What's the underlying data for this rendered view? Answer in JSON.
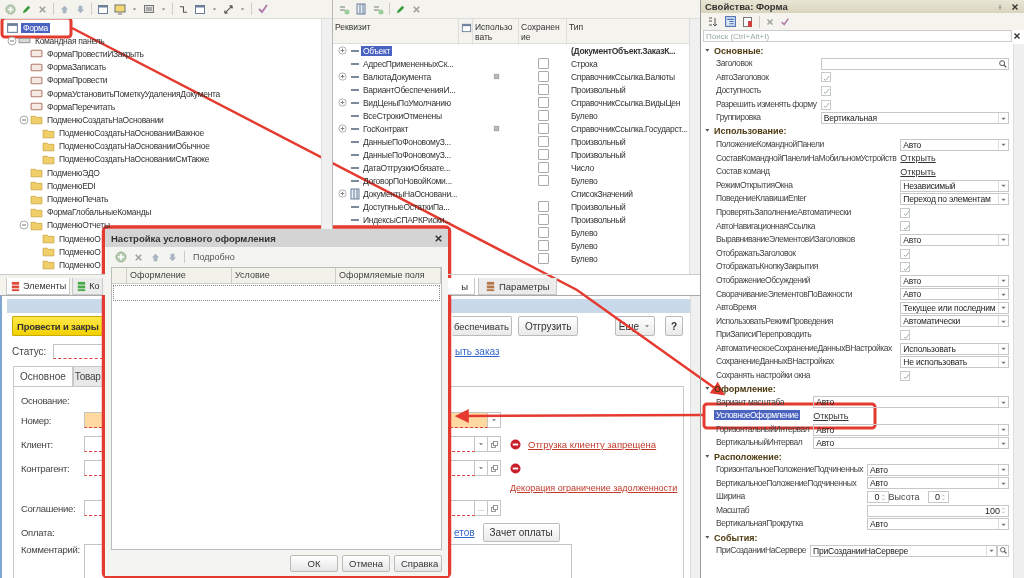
{
  "elements_tree": {
    "root": {
      "label": "Форма",
      "selected": true
    },
    "items": [
      {
        "label": "Командная панель",
        "kind": "panel",
        "expanded": true,
        "selected": false,
        "children": [
          {
            "label": "ФормаПровестиИЗакрыть",
            "kind": "button",
            "selected": false
          },
          {
            "label": "ФормаЗаписать",
            "kind": "button",
            "selected": false
          },
          {
            "label": "ФормаПровести",
            "kind": "button",
            "selected": false
          },
          {
            "label": "ФормаУстановитьПометкуУдаленияДокумента",
            "kind": "button",
            "selected": false
          },
          {
            "label": "ФормаПеречитать",
            "kind": "button",
            "selected": false
          },
          {
            "label": "ПодменюСоздатьНаОсновании",
            "kind": "submenu",
            "expanded": true,
            "selected": false,
            "children": [
              {
                "label": "ПодменюСоздатьНаОснованииВажное",
                "kind": "submenu",
                "selected": false
              },
              {
                "label": "ПодменюСоздатьНаОснованииОбычное",
                "kind": "submenu",
                "selected": false
              },
              {
                "label": "ПодменюСоздатьНаОснованииСмТакже",
                "kind": "submenu",
                "selected": false
              }
            ]
          },
          {
            "label": "ПодменюЭДО",
            "kind": "submenu",
            "selected": false
          },
          {
            "label": "ПодменюEDI",
            "kind": "submenu",
            "selected": false
          },
          {
            "label": "ПодменюПечать",
            "kind": "submenu",
            "selected": false
          },
          {
            "label": "ФормаГлобальныеКоманды",
            "kind": "submenu",
            "selected": false
          },
          {
            "label": "ПодменюОтчеты",
            "kind": "submenu",
            "expanded": true,
            "selected": false,
            "children": [
              {
                "label": "ПодменюО",
                "kind": "submenu",
                "selected": false
              },
              {
                "label": "ПодменюО",
                "kind": "submenu",
                "selected": false
              },
              {
                "label": "ПодменюО",
                "kind": "submenu",
                "selected": false
              }
            ]
          }
        ]
      }
    ],
    "tabs": [
      {
        "label": "Элементы",
        "selected": true
      },
      {
        "label": "Ко",
        "selected": false
      }
    ]
  },
  "attributes": {
    "columns": [
      "Реквизит",
      "Использовать",
      "Сохранение",
      "Тип"
    ],
    "rows": [
      {
        "name": "Объект",
        "kind": "object",
        "expandable": true,
        "used": false,
        "selected": true,
        "type": "(ДокументОбъект.ЗаказК..."
      },
      {
        "name": "АдресПримененныхСк...",
        "kind": "attribute",
        "expandable": false,
        "used": false,
        "saved": false,
        "selected": false,
        "type": "Строка"
      },
      {
        "name": "ВалютаДокумента",
        "kind": "attribute",
        "expandable": true,
        "used": true,
        "saved": false,
        "selected": false,
        "type": "СправочникСсылка.Валюты"
      },
      {
        "name": "ВариантОбеспеченияИ...",
        "kind": "attribute",
        "expandable": false,
        "used": false,
        "saved": false,
        "selected": false,
        "type": "Произвольный"
      },
      {
        "name": "ВидЦеныПоУмолчанию",
        "kind": "attribute",
        "expandable": true,
        "used": false,
        "saved": false,
        "selected": false,
        "type": "СправочникСсылка.ВидыЦен"
      },
      {
        "name": "ВсеСтрокиОтменены",
        "kind": "attribute",
        "expandable": false,
        "used": false,
        "saved": false,
        "selected": false,
        "type": "Булево"
      },
      {
        "name": "ГосКонтракт",
        "kind": "attribute",
        "expandable": true,
        "used": true,
        "saved": false,
        "selected": false,
        "type": "СправочникСсылка.Государст..."
      },
      {
        "name": "ДанныеПоФоновомуЗ...",
        "kind": "attribute",
        "expandable": false,
        "used": false,
        "saved": false,
        "selected": false,
        "type": "Произвольный"
      },
      {
        "name": "ДанныеПоФоновомуЗ...",
        "kind": "attribute",
        "expandable": false,
        "used": false,
        "saved": false,
        "selected": false,
        "type": "Произвольный"
      },
      {
        "name": "ДатаОтгрузкиОбязате...",
        "kind": "attribute",
        "expandable": false,
        "used": false,
        "saved": false,
        "selected": false,
        "type": "Число"
      },
      {
        "name": "ДоговорПоНовойКоми...",
        "kind": "attribute",
        "expandable": false,
        "used": false,
        "saved": false,
        "selected": false,
        "type": "Булево"
      },
      {
        "name": "ДокументыНаОсновани...",
        "kind": "list",
        "expandable": true,
        "used": false,
        "selected": false,
        "type": "СписокЗначений"
      },
      {
        "name": "ДоступныеОстаткиПа...",
        "kind": "attribute",
        "expandable": false,
        "used": false,
        "saved": false,
        "selected": false,
        "type": "Произвольный"
      },
      {
        "name": "ИндексыСПАРКРиски...",
        "kind": "attribute",
        "expandable": false,
        "used": false,
        "saved": false,
        "selected": false,
        "type": "Произвольный"
      },
      {
        "kind": "attribute",
        "expandable": false,
        "used": false,
        "saved": false,
        "selected": false,
        "type": "Булево"
      },
      {
        "kind": "attribute",
        "expandable": false,
        "used": false,
        "saved": false,
        "selected": false,
        "type": "Булево"
      },
      {
        "kind": "attribute",
        "expandable": false,
        "used": false,
        "saved": false,
        "selected": false,
        "type": "Булево"
      }
    ],
    "tabs": [
      {
        "label": "ы",
        "selected": true
      },
      {
        "label": "Параметры",
        "selected": false
      }
    ]
  },
  "document_form": {
    "commands": [
      {
        "label": "Провести и закры",
        "kind": "primary"
      },
      {
        "label": "беспечивать",
        "kind": "button"
      },
      {
        "label": "Отгрузить",
        "kind": "button"
      },
      {
        "label": "Еще",
        "kind": "menu"
      },
      {
        "label": "?",
        "kind": "help"
      }
    ],
    "status_label": "Статус:",
    "status_required": true,
    "status_link": "ыть заказ",
    "tabs": [
      {
        "label": "Основное",
        "selected": true
      },
      {
        "label": "Товар",
        "selected": false
      }
    ],
    "fields": [
      {
        "kind": "caption",
        "label": "Основание:"
      },
      {
        "kind": "select",
        "label": "Номер:",
        "highlighted": true,
        "required": false
      },
      {
        "kind": "reference",
        "label": "Клиент:",
        "highlighted": false,
        "required": true,
        "warning": true,
        "link": "Отгрузка клиенту запрещена"
      },
      {
        "kind": "reference",
        "label": "Контрагент:",
        "highlighted": false,
        "required": true,
        "warning": true
      },
      {
        "kind": "decoration",
        "link": "Декорация ограничение задолженности"
      },
      {
        "kind": "choice",
        "label": "Соглашение:",
        "highlighted": false,
        "required": true,
        "button_text": "..."
      },
      {
        "kind": "payment",
        "label": "Оплата:",
        "link": "етов",
        "button": "Зачет оплаты"
      },
      {
        "kind": "text_area",
        "label": "Комментарий:"
      }
    ]
  },
  "properties": {
    "title": "Свойства: Форма",
    "search_placeholder": "Поиск (Ctrl+Alt+I)",
    "sections": [
      {
        "title": "Основные:",
        "expanded": true,
        "rows": [
          {
            "label": "Заголовок",
            "kind": "search_field",
            "selected": false
          },
          {
            "label": "АвтоЗаголовок",
            "kind": "check",
            "checked": true,
            "selected": false
          },
          {
            "label": "Доступность",
            "kind": "check",
            "checked": true,
            "selected": false
          },
          {
            "label": "Разрешить изменять форму",
            "kind": "check",
            "checked": true,
            "selected": false
          },
          {
            "label": "Группировка",
            "kind": "select",
            "value": "Вертикальная",
            "selected": false
          }
        ]
      },
      {
        "title": "Использование:",
        "expanded": true,
        "rows": [
          {
            "label": "ПоложениеКоманднойПанели",
            "kind": "select",
            "value": "Авто",
            "selected": false
          },
          {
            "label": "СоставКоманднойПанелиНаМобильномУстройств",
            "kind": "link",
            "value": "Открыть",
            "selected": false
          },
          {
            "label": "Состав команд",
            "kind": "link",
            "value": "Открыть",
            "selected": false
          },
          {
            "label": "РежимОткрытияОкна",
            "kind": "select",
            "value": "Независимый",
            "selected": false
          },
          {
            "label": "ПоведениеКлавишиEnter",
            "kind": "select",
            "value": "Переход по элементам",
            "selected": false
          },
          {
            "label": "ПроверятьЗаполнениеАвтоматически",
            "kind": "check",
            "checked": true,
            "selected": false
          },
          {
            "label": "АвтоНавигационнаяСсылка",
            "kind": "check",
            "checked": true,
            "selected": false
          },
          {
            "label": "ВыравниваниеЭлементовИЗаголовков",
            "kind": "select",
            "value": "Авто",
            "selected": false
          },
          {
            "label": "ОтображатьЗаголовок",
            "kind": "check",
            "checked": true,
            "selected": false
          },
          {
            "label": "ОтображатьКнопкуЗакрытия",
            "kind": "check",
            "checked": true,
            "selected": false
          },
          {
            "label": "ОтображениеОбсуждений",
            "kind": "select",
            "value": "Авто",
            "selected": false
          },
          {
            "label": "СворачиваниеЭлементовПоВажности",
            "kind": "select",
            "value": "Авто",
            "selected": false
          },
          {
            "label": "АвтоВремя",
            "kind": "select",
            "value": "Текущее или последним",
            "selected": false
          },
          {
            "label": "ИспользоватьРежимПроведения",
            "kind": "select",
            "value": "Автоматически",
            "selected": false
          },
          {
            "label": "ПриЗаписиПерепроводить",
            "kind": "check",
            "checked": true,
            "selected": false
          },
          {
            "label": "АвтоматическоеСохранениеДанныхВНастройках",
            "kind": "select",
            "value": "Использовать",
            "selected": false
          },
          {
            "label": "СохранениеДанныхВНастройках",
            "kind": "select",
            "value": "Не использовать",
            "selected": false
          },
          {
            "label": "Сохранять настройки окна",
            "kind": "check",
            "checked": true,
            "selected": false
          }
        ]
      },
      {
        "title": "Оформление:",
        "expanded": true,
        "rows": [
          {
            "label": "Вариант масштаба",
            "kind": "select",
            "value": "Авто",
            "selected": false
          },
          {
            "label": "УсловноеОформление",
            "kind": "link",
            "value": "Открыть",
            "selected": true
          },
          {
            "label": "ГоризонтальныйИнтервал",
            "kind": "select",
            "value": "Авто",
            "selected": false
          },
          {
            "label": "ВертикальныйИнтервал",
            "kind": "select",
            "value": "Авто",
            "selected": false
          }
        ]
      },
      {
        "title": "Расположение:",
        "expanded": true,
        "rows": [
          {
            "label": "ГоризонтальноеПоложениеПодчиненных",
            "kind": "select",
            "value": "Авто",
            "selected": false
          },
          {
            "label": "ВертикальноеПоложениеПодчиненных",
            "kind": "select",
            "value": "Авто",
            "selected": false
          },
          {
            "label": "Ширина",
            "kind": "spin_pair",
            "value": "0",
            "label2": "Высота",
            "value2": "0",
            "selected": false
          },
          {
            "label": "Масштаб",
            "kind": "spin",
            "value": "100",
            "selected": false
          },
          {
            "label": "ВертикальнаяПрокрутка",
            "kind": "select",
            "value": "Авто",
            "selected": false
          }
        ]
      },
      {
        "title": "События:",
        "expanded": true,
        "rows": [
          {
            "label": "ПриСозданииНаСервере",
            "kind": "select_search",
            "value": "ПриСозданииНаСервере",
            "selected": false
          }
        ]
      }
    ]
  },
  "dialog": {
    "title": "Настройка условного оформления",
    "toolbar_button": "Подробно",
    "columns": [
      "Оформление",
      "Условие",
      "Оформляемые поля"
    ],
    "buttons": [
      "ОК",
      "Отмена",
      "Справка"
    ]
  }
}
